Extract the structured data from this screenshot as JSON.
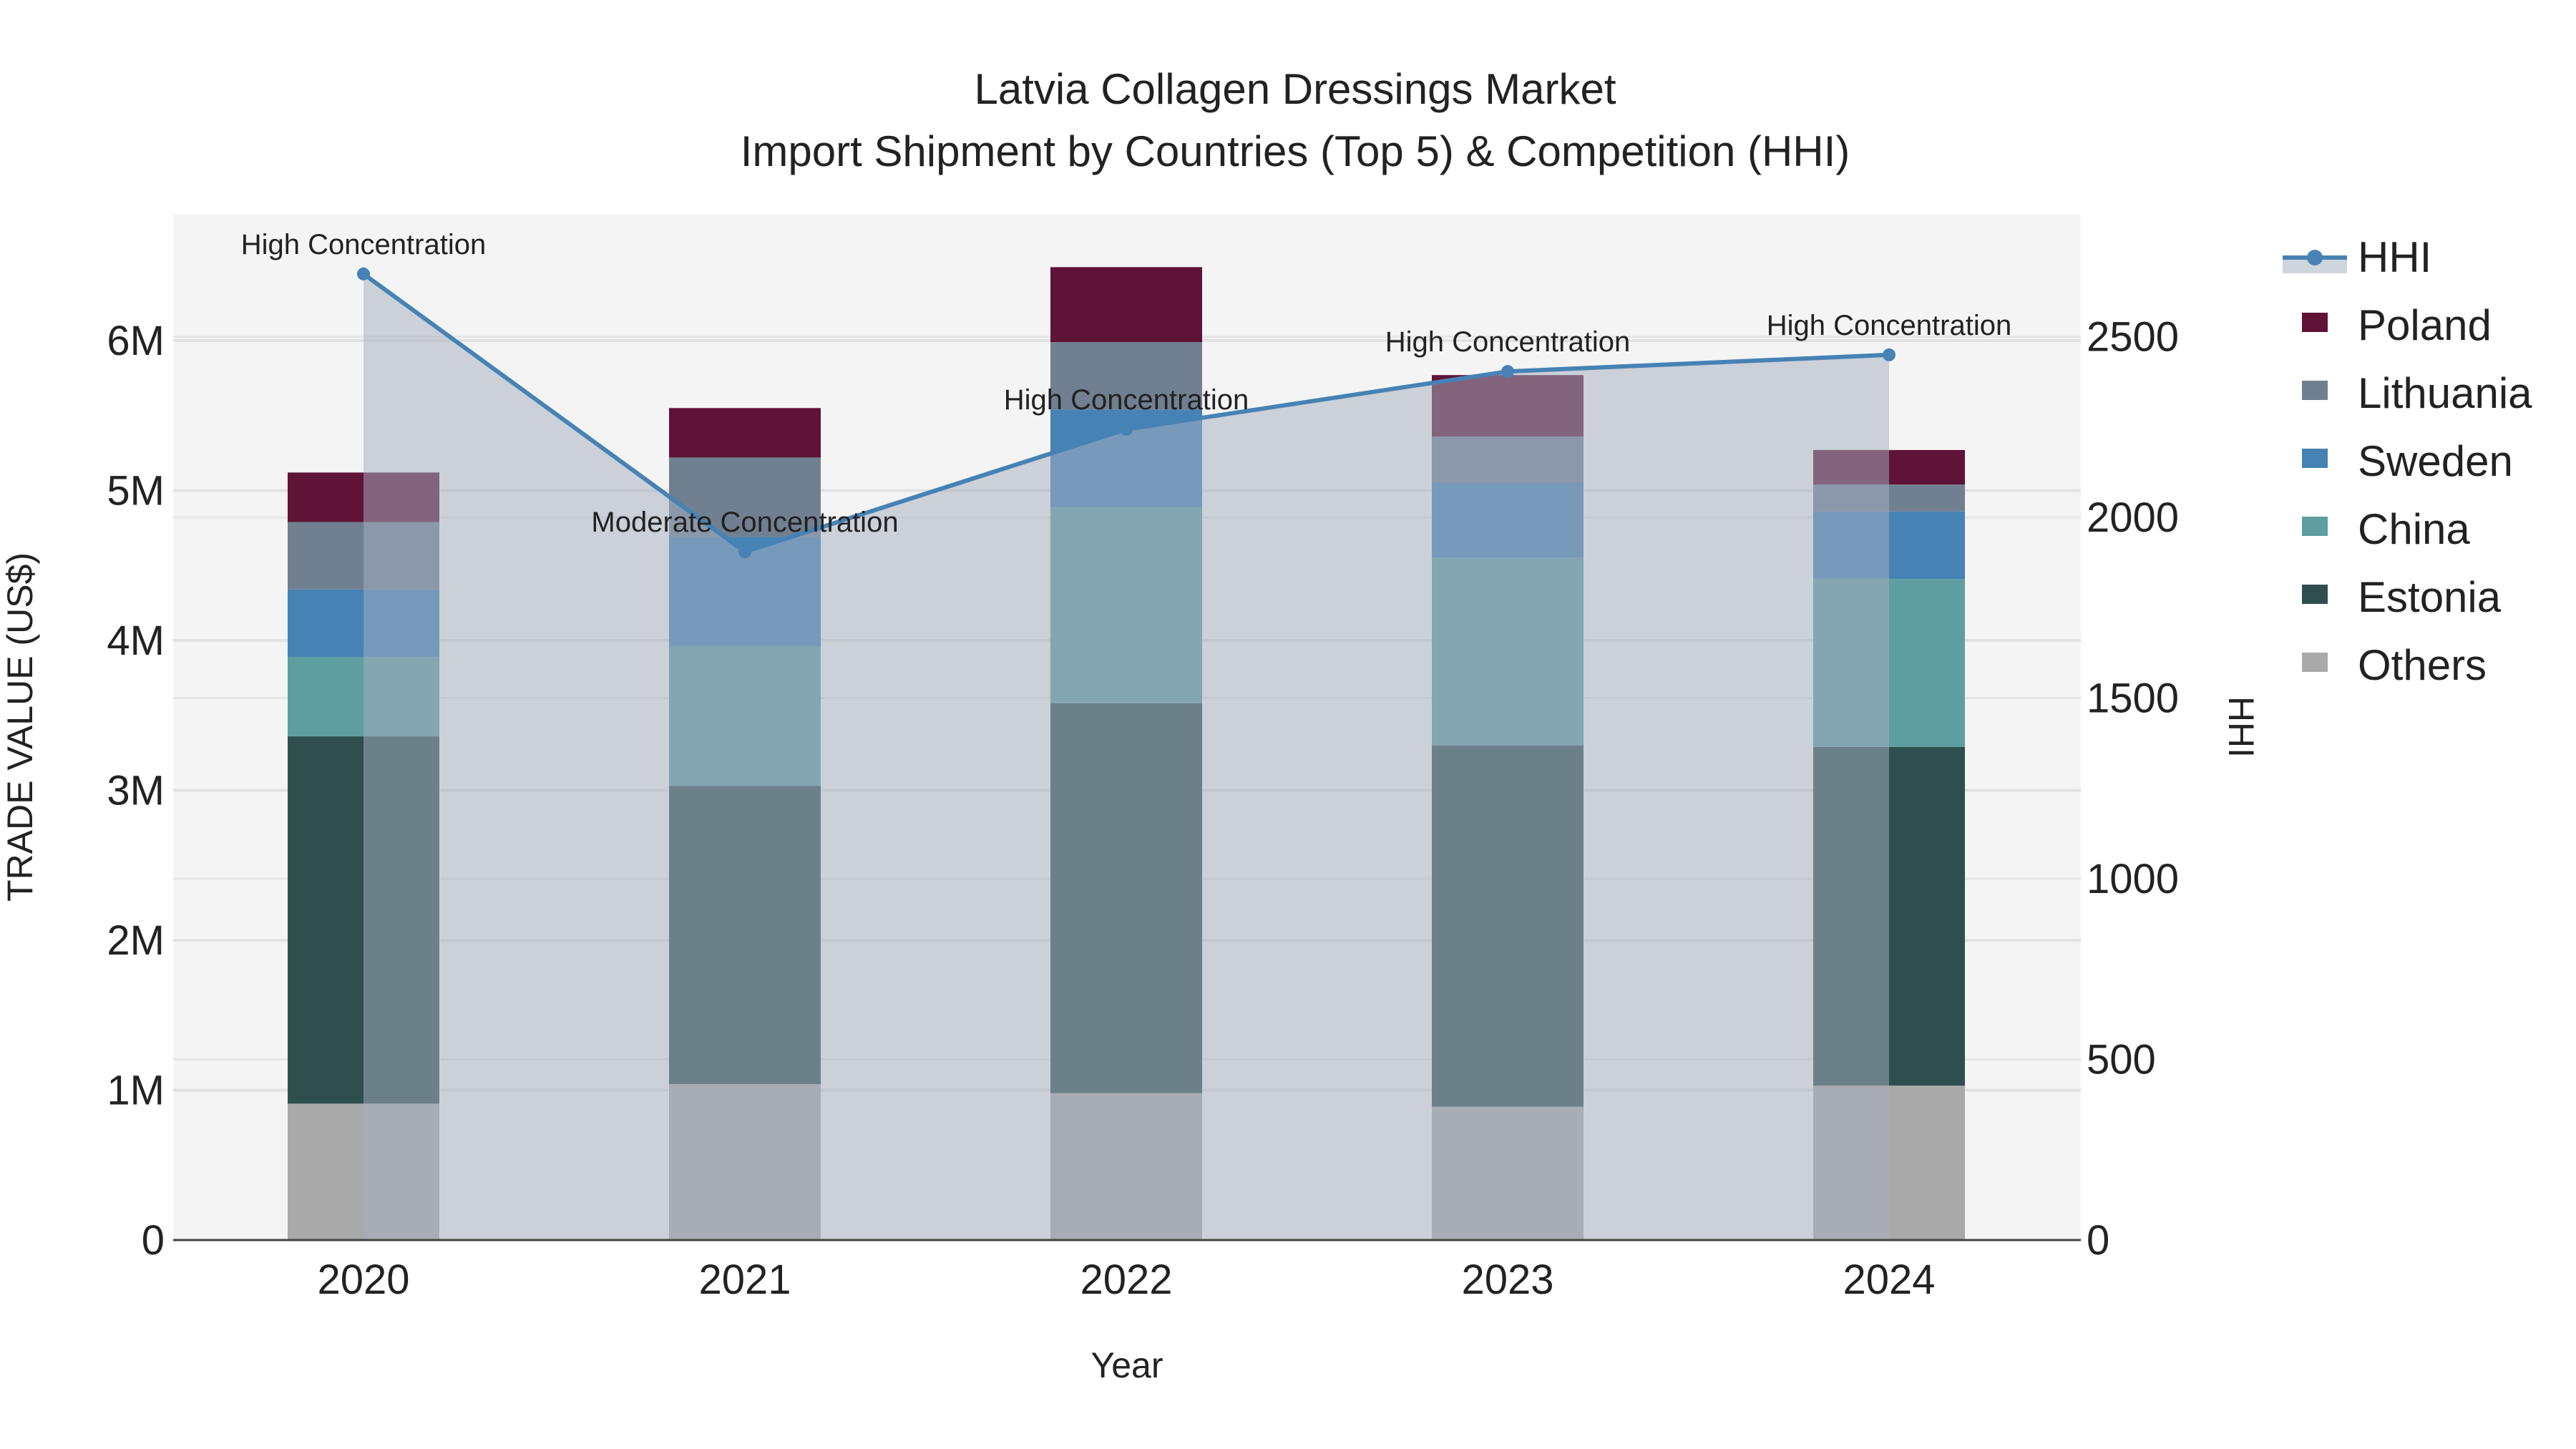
{
  "chart_data": {
    "type": "bar",
    "title": "Latvia Collagen Dressings Market",
    "subtitle": "Import Shipment by Countries (Top 5) & Competition (HHI)",
    "xlabel": "Year",
    "ylabel": "TRADE VALUE (US$)",
    "y2label": "HHI",
    "categories": [
      "2020",
      "2021",
      "2022",
      "2023",
      "2024"
    ],
    "ylim": [
      0,
      6840000
    ],
    "y2lim": [
      0,
      2838
    ],
    "yticks": [
      0,
      1000000,
      2000000,
      3000000,
      4000000,
      5000000,
      6000000
    ],
    "ytick_labels": [
      "0",
      "1M",
      "2M",
      "3M",
      "4M",
      "5M",
      "6M"
    ],
    "y2ticks": [
      0,
      500,
      1000,
      1500,
      2000,
      2500
    ],
    "y2tick_labels": [
      "0",
      "500",
      "1000",
      "1500",
      "2000",
      "2500"
    ],
    "stack_order": [
      "Others",
      "Estonia",
      "China",
      "Sweden",
      "Lithuania",
      "Poland"
    ],
    "series": [
      {
        "name": "Poland",
        "color": "#5f1336",
        "values": [
          330000,
          330000,
          500000,
          410000,
          230000
        ]
      },
      {
        "name": "Lithuania",
        "color": "#708090",
        "values": [
          450000,
          530000,
          450000,
          310000,
          180000
        ]
      },
      {
        "name": "Sweden",
        "color": "#4682b4",
        "values": [
          450000,
          730000,
          650000,
          500000,
          450000
        ]
      },
      {
        "name": "China",
        "color": "#5f9ea0",
        "values": [
          530000,
          930000,
          1310000,
          1250000,
          1120000
        ]
      },
      {
        "name": "Estonia",
        "color": "#2f4f4f",
        "values": [
          2450000,
          1990000,
          2600000,
          2410000,
          2260000
        ]
      },
      {
        "name": "Others",
        "color": "#a9a9a9",
        "values": [
          910000,
          1040000,
          980000,
          890000,
          1030000
        ]
      }
    ],
    "hhi": {
      "name": "HHI",
      "color": "#4682b4",
      "values": [
        2674,
        1905,
        2244,
        2404,
        2450
      ],
      "annotations": [
        "High Concentration",
        "Moderate Concentration",
        "High Concentration",
        "High Concentration",
        "High Concentration"
      ]
    },
    "legend_placement": "right",
    "legend": [
      "HHI",
      "Poland",
      "Lithuania",
      "Sweden",
      "China",
      "Estonia",
      "Others"
    ],
    "grid": true
  }
}
